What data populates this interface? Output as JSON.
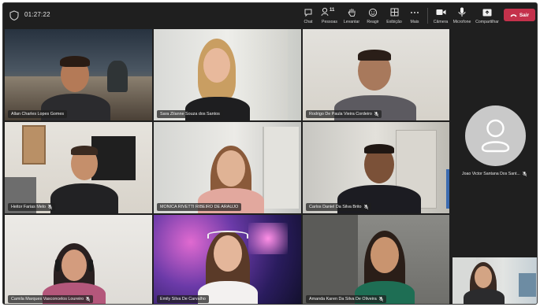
{
  "meeting": {
    "timer": "01:27:22",
    "colors": {
      "background": "#1f1f1f",
      "leave": "#c4314b",
      "text": "#e8e8e8"
    }
  },
  "toolbar": {
    "chat_label": "Chat",
    "people_label": "Pessoas",
    "people_count": "11",
    "raise_label": "Levantar",
    "react_label": "Reagir",
    "view_label": "Exibição",
    "more_label": "Mais",
    "camera_label": "Câmera",
    "mic_label": "Microfone",
    "share_label": "Compartilhar",
    "leave_label": "Sair"
  },
  "participants": [
    {
      "name": "Allan Charles Lopes Gomes",
      "muted": false
    },
    {
      "name": "Sara Zilanne Souza dos Santos",
      "muted": false
    },
    {
      "name": "Rodrigo De Paula Vieira Cordeiro",
      "muted": true
    },
    {
      "name": "Heitor Farias Melo",
      "muted": true
    },
    {
      "name": "MONICA RIVETTI RIBEIRO DE ARAUJO",
      "muted": false
    },
    {
      "name": "Carlos Daniel Da Silva Brito",
      "muted": true
    },
    {
      "name": "Camila Marques Vasconcelos Loureiro",
      "muted": true
    },
    {
      "name": "Emily Silva De Carvalho",
      "muted": false
    },
    {
      "name": "Amanda Karen Da Silva De Oliveira",
      "muted": true
    }
  ],
  "side_participant": {
    "name": "Joao Victor Santana Dos Sant...",
    "muted": true
  }
}
